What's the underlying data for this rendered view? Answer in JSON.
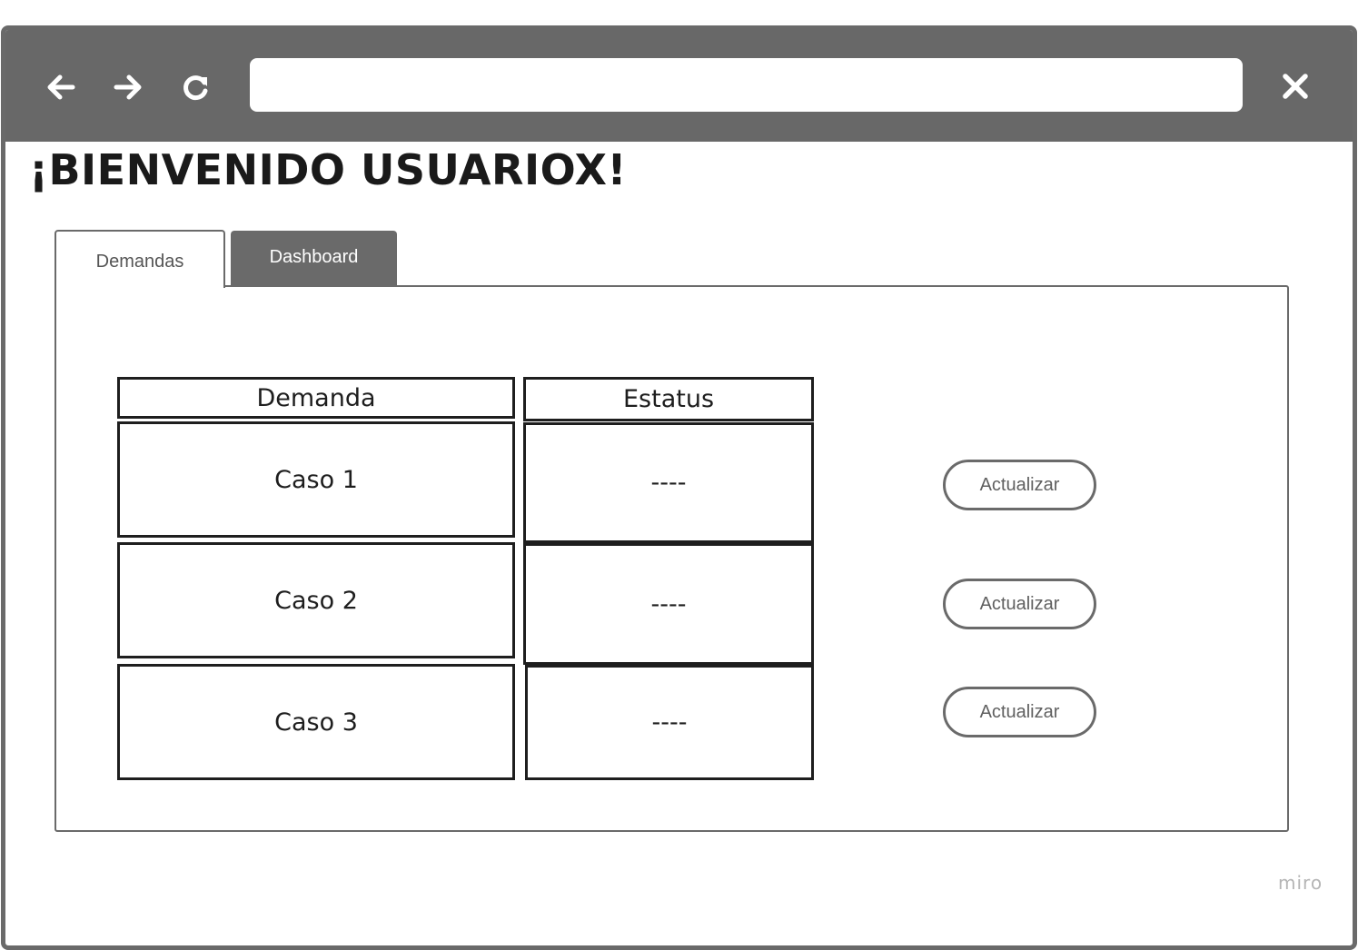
{
  "browser": {
    "back_icon": "arrow-left-icon",
    "forward_icon": "arrow-right-icon",
    "reload_icon": "reload-icon",
    "close_icon": "close-icon",
    "url_value": "",
    "chrome_color": "#686868"
  },
  "page": {
    "title": "¡BIENVENIDO USUARIOX!"
  },
  "tabs": [
    {
      "label": "Demandas",
      "active": true
    },
    {
      "label": "Dashboard",
      "active": false
    }
  ],
  "table": {
    "columns": [
      "Demanda",
      "Estatus"
    ],
    "rows": [
      {
        "demanda": "Caso 1",
        "estatus": "----",
        "action": "Actualizar"
      },
      {
        "demanda": "Caso 2",
        "estatus": "----",
        "action": "Actualizar"
      },
      {
        "demanda": "Caso 3",
        "estatus": "----",
        "action": "Actualizar"
      }
    ]
  },
  "watermark": "miro"
}
